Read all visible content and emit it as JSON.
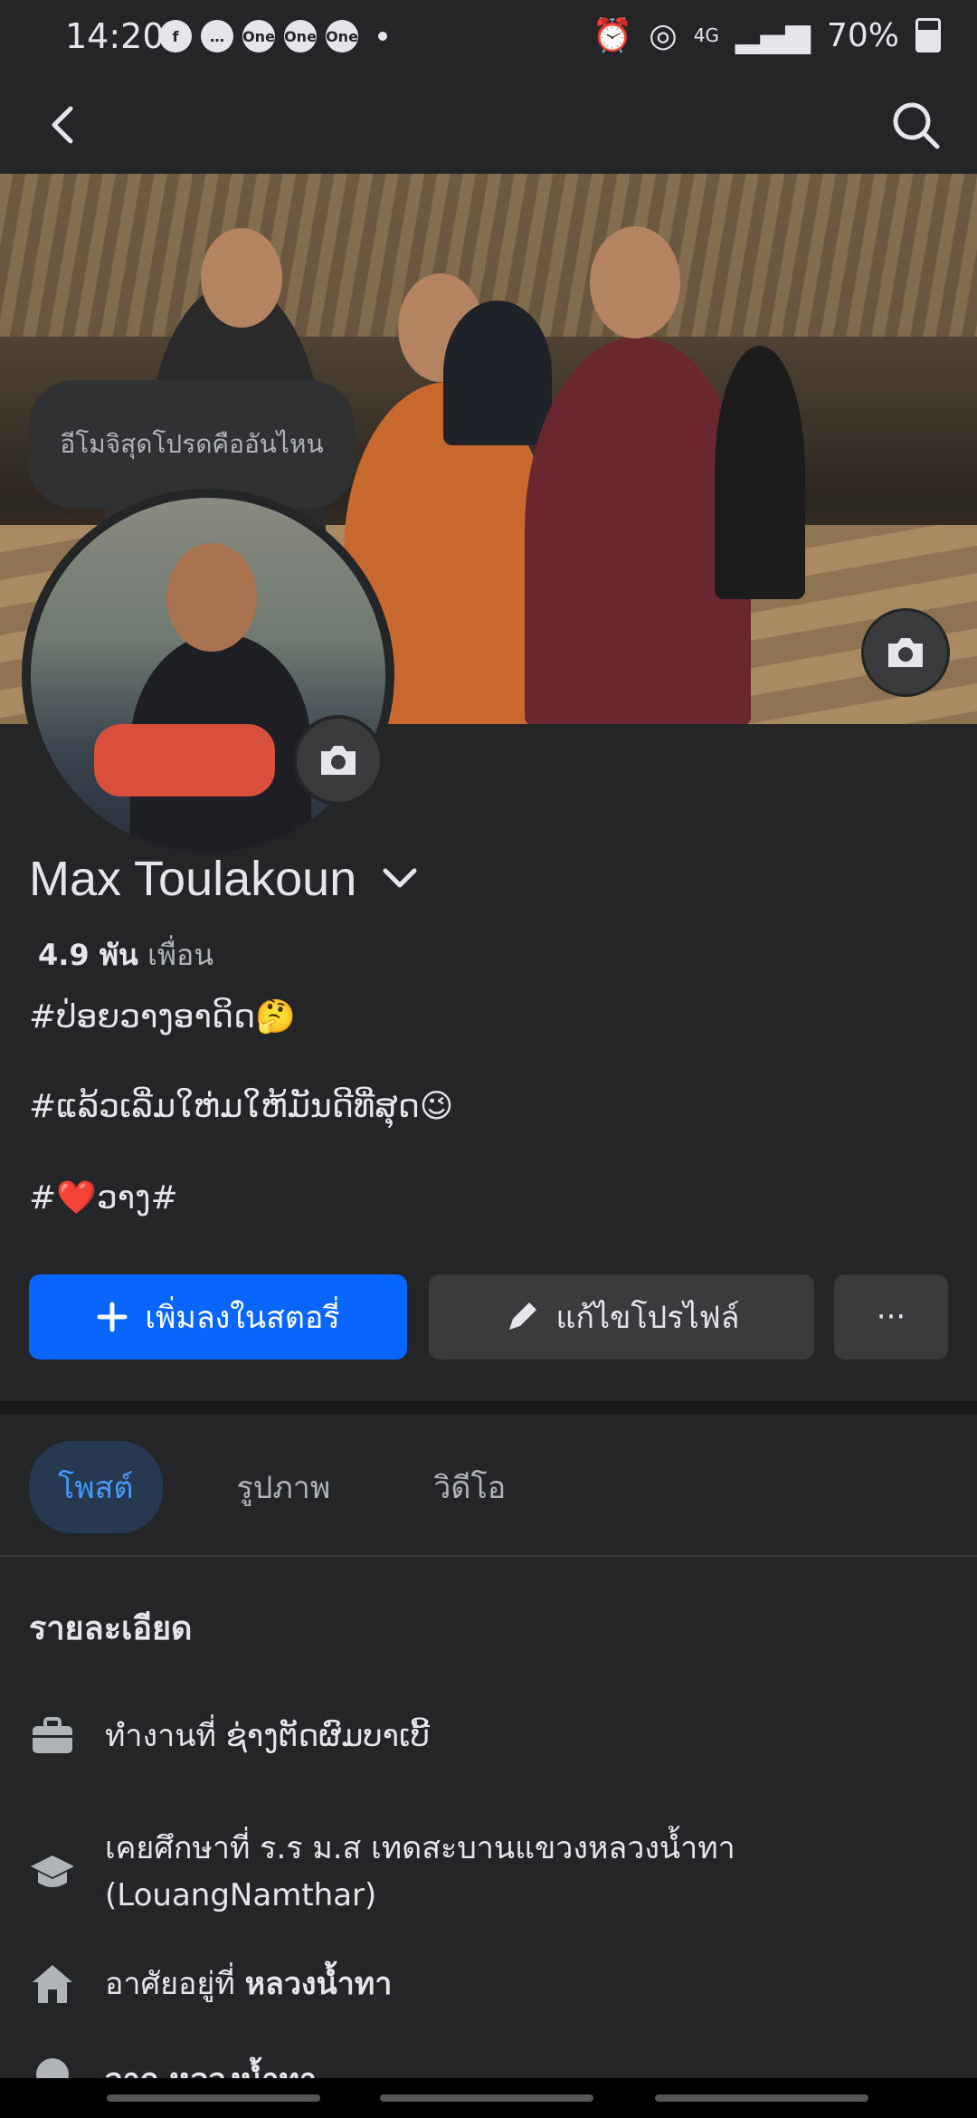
{
  "status_bar": {
    "time": "14:20",
    "left_icons": [
      "facebook-icon",
      "messenger-icon",
      "one-icon",
      "one-icon",
      "one-icon"
    ],
    "battery_percent": "70%",
    "battery_level": 0.7,
    "network": "4G",
    "right_icons": [
      "alarm-icon",
      "hotspot-icon",
      "network-4g-icon",
      "signal-icon",
      "battery-icon"
    ]
  },
  "topbar": {
    "back_icon": "chevron-left-icon",
    "search_icon": "search-icon"
  },
  "cover": {
    "camera_icon": "camera-icon"
  },
  "note_bubble": {
    "text": "อีโมจิสุดโปรดคืออันไหน"
  },
  "avatar": {
    "camera_icon": "camera-icon"
  },
  "profile": {
    "name": "Max Toulakoun",
    "friends_count": "4.9 พัน",
    "friends_label": "เพื่อน",
    "bio_lines": [
      "#ປ່ອຍວາງອາດິດ🤔",
      "#ແລ້ວເລີ່ມໃຫ່ມໃຫ້ມັນດີທີ່ສຸດ😉",
      "#❤️ວາງ#"
    ]
  },
  "actions": {
    "add_story": "เพิ่มลงในสตอรี่",
    "edit_profile": "แก้ไขโปรไฟล์",
    "more": "···"
  },
  "tabs": [
    {
      "label": "โพสต์",
      "active": true
    },
    {
      "label": "รูปภาพ",
      "active": false
    },
    {
      "label": "วิดีโอ",
      "active": false
    }
  ],
  "details": {
    "title": "รายละเอียด",
    "work": "ทำงานที่ ຊ່າງຕັດຜົມບາເບີ້",
    "education_line1": "เคยศึกษาที่ ร.ร ม.ส เทดสะบานแขวงหลวงน้ำทา",
    "education_line2": "(LouangNamthar)",
    "lives_prefix": "อาศัยอยู่ที่",
    "lives_place": "หลวงน้ำทา",
    "from_partial": "จาก หลวงน้ำทา"
  },
  "colors": {
    "background": "#242526",
    "primary_button": "#0866ff",
    "secondary_button": "#3a3b3c",
    "active_tab_bg": "#263951",
    "active_tab_text": "#4599ff"
  }
}
